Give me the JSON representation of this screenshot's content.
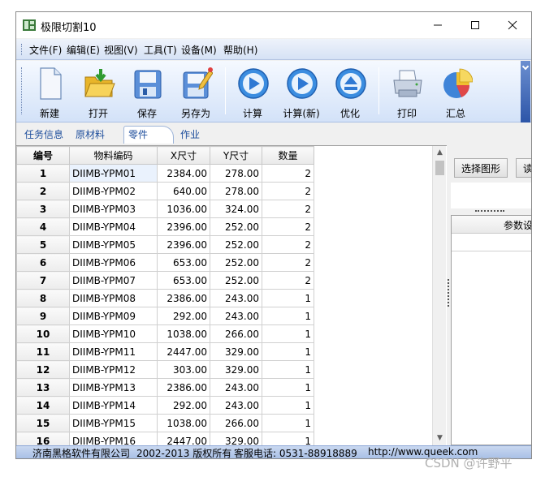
{
  "window": {
    "title": "极限切割10"
  },
  "menu": [
    "文件(F)",
    "编辑(E)",
    "视图(V)",
    "工具(T)",
    "设备(M)",
    "帮助(H)"
  ],
  "toolbar": {
    "new_label": "新建",
    "open_label": "打开",
    "save_label": "保存",
    "saveas_label": "另存为",
    "calc_label": "计算",
    "calc_new_label": "计算(新)",
    "optimize_label": "优化",
    "print_label": "打印",
    "summary_label": "汇总"
  },
  "tabs": [
    "任务信息",
    "原材料",
    "零件",
    "作业"
  ],
  "active_tab": "零件",
  "grid": {
    "headers": [
      "编号",
      "物料编码",
      "X尺寸",
      "Y尺寸",
      "数量"
    ],
    "rows": [
      [
        "1",
        "DIIMB-YPM01",
        "2384.00",
        "278.00",
        "2"
      ],
      [
        "2",
        "DIIMB-YPM02",
        "640.00",
        "278.00",
        "2"
      ],
      [
        "3",
        "DIIMB-YPM03",
        "1036.00",
        "324.00",
        "2"
      ],
      [
        "4",
        "DIIMB-YPM04",
        "2396.00",
        "252.00",
        "2"
      ],
      [
        "5",
        "DIIMB-YPM05",
        "2396.00",
        "252.00",
        "2"
      ],
      [
        "6",
        "DIIMB-YPM06",
        "653.00",
        "252.00",
        "2"
      ],
      [
        "7",
        "DIIMB-YPM07",
        "653.00",
        "252.00",
        "2"
      ],
      [
        "8",
        "DIIMB-YPM08",
        "2386.00",
        "243.00",
        "1"
      ],
      [
        "9",
        "DIIMB-YPM09",
        "292.00",
        "243.00",
        "1"
      ],
      [
        "10",
        "DIIMB-YPM10",
        "1038.00",
        "266.00",
        "1"
      ],
      [
        "11",
        "DIIMB-YPM11",
        "2447.00",
        "329.00",
        "1"
      ],
      [
        "12",
        "DIIMB-YPM12",
        "303.00",
        "329.00",
        "1"
      ],
      [
        "13",
        "DIIMB-YPM13",
        "2386.00",
        "243.00",
        "1"
      ],
      [
        "14",
        "DIIMB-YPM14",
        "292.00",
        "243.00",
        "1"
      ],
      [
        "15",
        "DIIMB-YPM15",
        "1038.00",
        "266.00",
        "1"
      ],
      [
        "16",
        "DIIMB-YPM16",
        "2447.00",
        "329.00",
        "1"
      ]
    ]
  },
  "right_panel": {
    "select_shape_label": "选择图形",
    "read_label": "读",
    "param_header": "参数设"
  },
  "status": {
    "company": "济南黑格软件有限公司",
    "copyright": "2002-2013 版权所有",
    "phone": "客服电话: 0531-88918889",
    "url": "http://www.queek.com"
  },
  "watermark": "CSDN @许野平",
  "colors": {
    "accent": "#2f6fd4",
    "toolbar_top": "#f5f9ff",
    "toolbar_bottom": "#d3e2f8",
    "status": "#a9c0e6"
  }
}
